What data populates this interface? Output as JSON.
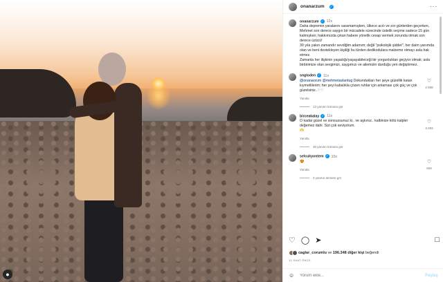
{
  "post": {
    "username": "onanarzum",
    "image_alt": "couple embracing on rocky beach at sunset"
  },
  "caption": {
    "username": "onanarzum",
    "time": "12s",
    "text": "Daha depremin yaralarını saramamışken, ülkece acılı ve zor günlerden geçerken, Mehmet son derece saygın bir mücadele sürecinde üstelik seçime sadece 15 gün kalmışken; hakkımızda çıkan habere yönelik cevap vermek zorunda olmak son derece üzücü!",
    "text2": "30 yıla yakın zamandır sevdiğim adamım; değil \"psikolojik şiddet\", her daim yanımda olan ve beni destekleyen kişiliği bu türden dedikodulara malzeme olmayı asla hak etmez.",
    "text3": "Zamanla her ilişkinin yaşadığı/yaşayabileceği bir yorgunluktan geçiyor olmak; asla birbirimize olan sevgimizi, saygımızı ve ailemizin durduğu yeri değiştirmez."
  },
  "comments": [
    {
      "username": "sngloden",
      "time": "11s",
      "mention1": "@onanarzum",
      "mention2": "@mehmetaslantug",
      "text": "Dokundukları her şeye güzellik katan kıymetlilerim; her şeyi kabalıkla çözen ruhlar için anlaması çok güç ve çok güzelsiniz..♡♡",
      "likes": "2.968",
      "reply_label": "Yanıtla",
      "view_replies": "13 yanıtın tümünü gör"
    },
    {
      "username": "birceakalay",
      "time": "11s",
      "text": "O kadar güzel ve sonsuzsunuz ki.. ve aşkınız.. kalbinize kötü kalpler değemez dahi. Sizi çok seviyorum.",
      "emoji": "🫶",
      "likes": "3.293",
      "reply_label": "Yanıtla",
      "view_replies": "30 yanıtın tümünü gör"
    },
    {
      "username": "selcukyontem",
      "time": "10s",
      "text": "😍",
      "likes": "508",
      "reply_label": "Yanıtla",
      "view_replies": "3 yanıtın tümünü gör"
    }
  ],
  "likes": {
    "first": "caglar_corumlu",
    "connector": "ve",
    "others": "196.348 diğer kişi",
    "suffix": "beğendi"
  },
  "time_ago": "12 SAAT ÖNCE",
  "add_comment": {
    "placeholder": "Yorum ekle...",
    "post_label": "Paylaş"
  },
  "icons": {
    "like": "heart-icon",
    "comment": "comment-icon",
    "share": "share-icon",
    "save": "bookmark-icon",
    "more": "more-icon",
    "emoji": "emoji-icon"
  },
  "colors": {
    "verified": "#0095f6",
    "mention": "#00376b",
    "post_button": "#b2dffc"
  }
}
